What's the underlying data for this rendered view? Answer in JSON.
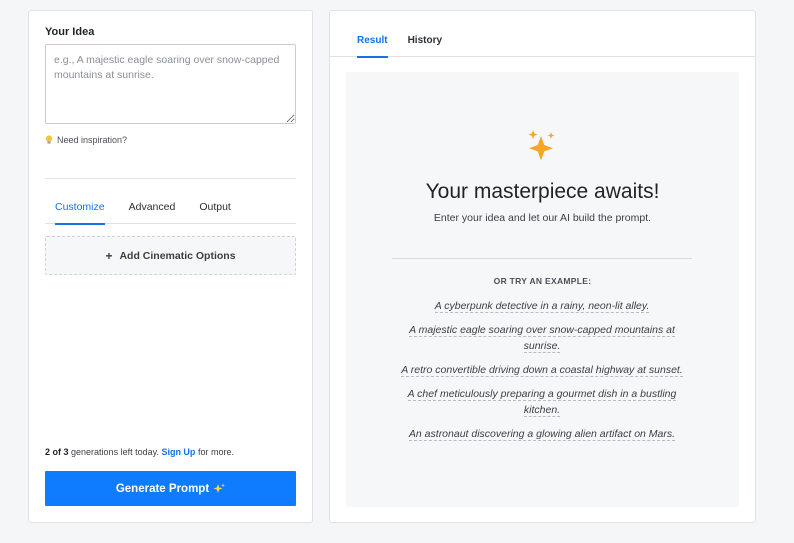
{
  "left": {
    "idea_label": "Your Idea",
    "idea_placeholder": "e.g., A majestic eagle soaring over snow-capped mountains at sunrise.",
    "idea_value": "",
    "inspiration_label": "Need inspiration?",
    "tabs": [
      {
        "label": "Customize",
        "active": true
      },
      {
        "label": "Advanced",
        "active": false
      },
      {
        "label": "Output",
        "active": false
      }
    ],
    "add_options_label": "Add Cinematic Options",
    "generations": {
      "used_count": "2 of 3",
      "text": "generations left today.",
      "signup_label": "Sign Up",
      "suffix": "for more."
    },
    "generate_label": "Generate Prompt"
  },
  "right": {
    "tabs": [
      {
        "label": "Result",
        "active": true
      },
      {
        "label": "History",
        "active": false
      }
    ],
    "title": "Your masterpiece awaits!",
    "subtitle": "Enter your idea and let our AI build the prompt.",
    "try_label": "OR TRY AN EXAMPLE:",
    "examples": [
      "A cyberpunk detective in a rainy, neon-lit alley.",
      "A majestic eagle soaring over snow-capped mountains at sunrise.",
      "A retro convertible driving down a coastal highway at sunset.",
      "A chef meticulously preparing a gourmet dish in a bustling kitchen.",
      "An astronaut discovering a glowing alien artifact on Mars."
    ]
  },
  "icons": {
    "inspiration": "lightbulb-icon",
    "add_options": "plus-icon",
    "generate": "sparkles-icon",
    "result": "sparkles-icon"
  },
  "colors": {
    "accent": "#1473e6",
    "button": "#0f7bff",
    "sparkle": "#f5a623"
  }
}
